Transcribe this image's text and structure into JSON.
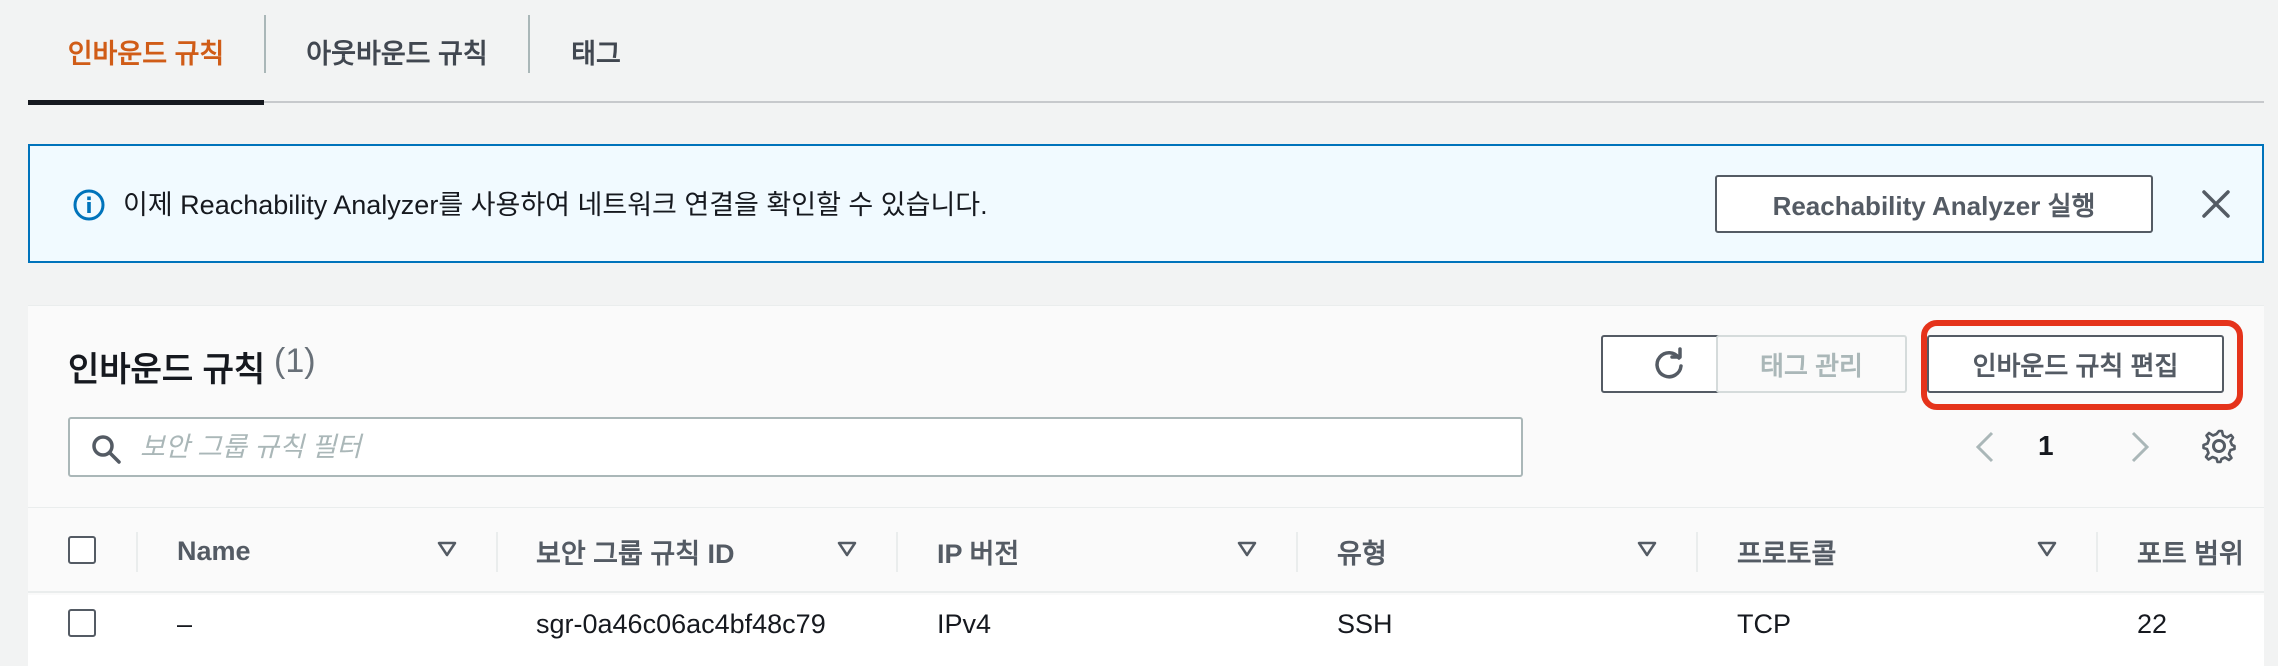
{
  "tabs": [
    {
      "label": "인바운드 규칙",
      "active": true
    },
    {
      "label": "아웃바운드 규칙",
      "active": false
    },
    {
      "label": "태그",
      "active": false
    }
  ],
  "alert": {
    "text": "이제 Reachability Analyzer를 사용하여 네트워크 연결을 확인할 수 있습니다.",
    "button_label": "Reachability Analyzer 실행",
    "icon": "info-icon"
  },
  "panel": {
    "title": "인바운드 규칙",
    "count": "(1)",
    "tags_button": "태그 관리",
    "edit_button": "인바운드 규칙 편집",
    "search_placeholder": "보안 그룹 규칙 필터",
    "page": "1"
  },
  "table": {
    "columns": [
      "Name",
      "보안 그룹 규칙 ID",
      "IP 버전",
      "유형",
      "프로토콜",
      "포트 범위"
    ],
    "rows": [
      {
        "name": "–",
        "rule_id": "sgr-0a46c06ac4bf48c79",
        "ip_version": "IPv4",
        "type": "SSH",
        "protocol": "TCP",
        "port_range": "22"
      }
    ]
  },
  "colors": {
    "accent_orange": "#d05c17",
    "info_blue": "#0073bb",
    "highlight_red": "#e5331b"
  }
}
